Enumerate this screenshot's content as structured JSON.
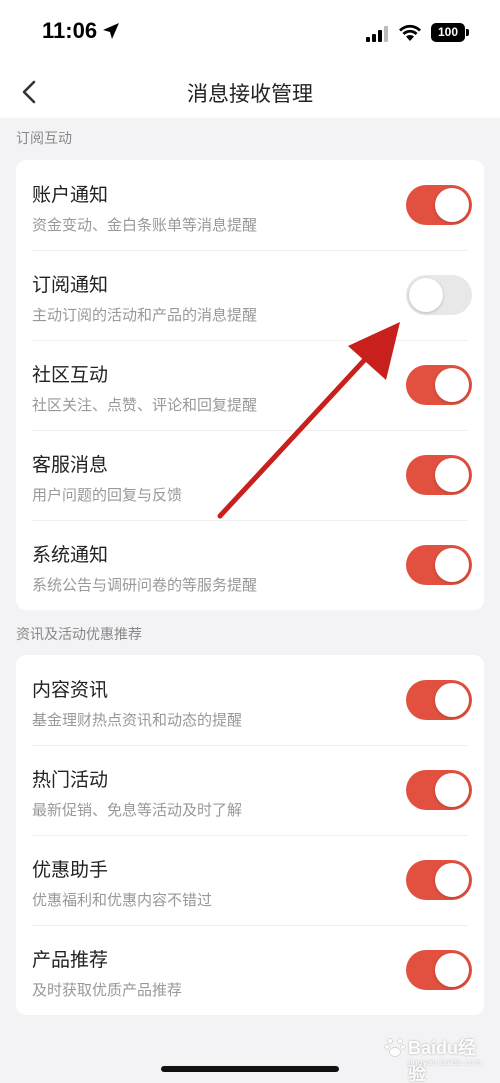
{
  "status_bar": {
    "time": "11:06",
    "battery": "100"
  },
  "nav": {
    "title": "消息接收管理"
  },
  "sections": [
    {
      "label": "订阅互动",
      "items": [
        {
          "title": "账户通知",
          "desc": "资金变动、金白条账单等消息提醒",
          "enabled": true
        },
        {
          "title": "订阅通知",
          "desc": "主动订阅的活动和产品的消息提醒",
          "enabled": false
        },
        {
          "title": "社区互动",
          "desc": "社区关注、点赞、评论和回复提醒",
          "enabled": true
        },
        {
          "title": "客服消息",
          "desc": "用户问题的回复与反馈",
          "enabled": true
        },
        {
          "title": "系统通知",
          "desc": "系统公告与调研问卷的等服务提醒",
          "enabled": true
        }
      ]
    },
    {
      "label": "资讯及活动优惠推荐",
      "items": [
        {
          "title": "内容资讯",
          "desc": "基金理财热点资讯和动态的提醒",
          "enabled": true
        },
        {
          "title": "热门活动",
          "desc": "最新促销、免息等活动及时了解",
          "enabled": true
        },
        {
          "title": "优惠助手",
          "desc": "优惠福利和优惠内容不错过",
          "enabled": true
        },
        {
          "title": "产品推荐",
          "desc": "及时获取优质产品推荐",
          "enabled": true
        }
      ]
    }
  ],
  "watermark": {
    "text": "Baidu经验",
    "sub": "jingyan.baidu.com"
  },
  "colors": {
    "toggle_on": "#e2503f",
    "toggle_off": "#e8e8e8",
    "arrow": "#c8201c",
    "background": "#f3f3f5"
  }
}
